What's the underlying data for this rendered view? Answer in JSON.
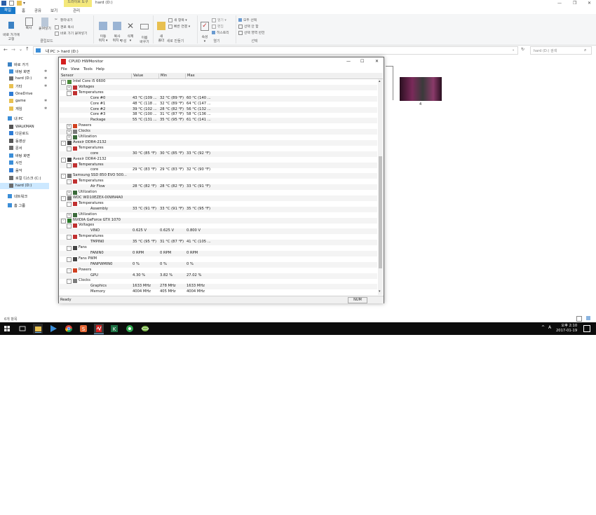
{
  "explorer": {
    "title": "hard (D:)",
    "context_tab": "드라이브 도구",
    "tabs": {
      "file": "파일",
      "home": "홈",
      "share": "공유",
      "view": "보기",
      "manage": "관리"
    },
    "ribbon": {
      "pin_label": "바로 가기에\n고정",
      "copy_label": "복사",
      "paste_label": "붙여넣기",
      "cut_label": "잘라내기",
      "copy_path_label": "경로 복사",
      "paste_shortcut_label": "바로 가기 붙여넣기",
      "clipboard_group": "클립보드",
      "move_to_label": "이동\n위치 ▾",
      "copy_to_label": "복사\n위치 ▾",
      "delete_label": "삭제\n▾",
      "rename_label": "이름\n바꾸기",
      "organize_group": "구성",
      "new_folder_label": "새\n폴더",
      "new_item_label": "새 항목 ▾",
      "easy_access_label": "빠른 연결 ▾",
      "new_group": "새로 만들기",
      "properties_label": "속성\n▾",
      "open_label": "열기 ▾",
      "edit_label": "편집",
      "history_label": "히스토리",
      "open_group": "열기",
      "select_all_label": "모두 선택",
      "select_none_label": "선택 안 함",
      "invert_label": "선택 영역 반전",
      "select_group": "선택"
    },
    "address": {
      "path": "내 PC  >  hard (D:)",
      "search_placeholder": "hard (D:) 검색"
    },
    "nav_items": [
      {
        "label": "바로 가기",
        "icon": "star-icon",
        "color": "#3b82c4"
      },
      {
        "label": "바탕 화면",
        "icon": "desktop-icon",
        "color": "#3b8ed8"
      },
      {
        "label": "hard (D:)",
        "icon": "drive-icon",
        "color": "#6b6b6b"
      },
      {
        "label": "기타",
        "icon": "folder-icon",
        "color": "#e8c050"
      },
      {
        "label": "OneDrive",
        "icon": "cloud-icon",
        "color": "#2f7bd4"
      },
      {
        "label": "game",
        "icon": "folder-icon",
        "color": "#e8c050"
      },
      {
        "label": "게임",
        "icon": "folder-icon",
        "color": "#e8c050"
      },
      {
        "label": "내 PC",
        "icon": "pc-icon",
        "color": "#3b8ed8"
      },
      {
        "label": "WALKMAN",
        "icon": "device-icon",
        "color": "#555555"
      },
      {
        "label": "다운로드",
        "icon": "download-icon",
        "color": "#2f7bd4"
      },
      {
        "label": "동영상",
        "icon": "video-icon",
        "color": "#555555"
      },
      {
        "label": "문서",
        "icon": "document-icon",
        "color": "#6b6b6b"
      },
      {
        "label": "바탕 화면",
        "icon": "desktop-icon",
        "color": "#3b8ed8"
      },
      {
        "label": "사진",
        "icon": "picture-icon",
        "color": "#3b8ed8"
      },
      {
        "label": "음악",
        "icon": "music-icon",
        "color": "#2f7bd4"
      },
      {
        "label": "로컬 디스크 (C:)",
        "icon": "drive-icon",
        "color": "#6b6b6b"
      },
      {
        "label": "hard (D:)",
        "icon": "drive-icon",
        "color": "#6b6b6b"
      },
      {
        "label": "네트워크",
        "icon": "network-icon",
        "color": "#3b8ed8"
      },
      {
        "label": "홈 그룹",
        "icon": "homegroup-icon",
        "color": "#3b8ed8"
      }
    ],
    "thumb_label": "4",
    "status": "6개 항목"
  },
  "hwmonitor": {
    "title": "CPUID HWMonitor",
    "menu": [
      "File",
      "View",
      "Tools",
      "Help"
    ],
    "columns": [
      "Sensor",
      "Value",
      "Min",
      "Max"
    ],
    "rows": [
      {
        "name": "Intel Core i5 6600",
        "level": 1,
        "expand": "-",
        "icon": "cpu-icon"
      },
      {
        "name": "Voltages",
        "level": 2,
        "expand": "+",
        "icon": "voltage-icon"
      },
      {
        "name": "Temperatures",
        "level": 2,
        "expand": "-",
        "icon": "thermometer-icon"
      },
      {
        "name": "Core #0",
        "level": 3,
        "value": "43 °C  (109 ...",
        "min": "32 °C  (89 °F)",
        "max": "60 °C  (140 ..."
      },
      {
        "name": "Core #1",
        "level": 3,
        "value": "48 °C  (118 ...",
        "min": "32 °C  (89 °F)",
        "max": "64 °C  (147 ..."
      },
      {
        "name": "Core #2",
        "level": 3,
        "value": "39 °C  (102 ...",
        "min": "28 °C  (82 °F)",
        "max": "56 °C  (132 ..."
      },
      {
        "name": "Core #3",
        "level": 3,
        "value": "38 °C  (100 ...",
        "min": "31 °C  (87 °F)",
        "max": "58 °C  (136 ..."
      },
      {
        "name": "Package",
        "level": 3,
        "value": "55 °C  (131 ...",
        "min": "35 °C  (95 °F)",
        "max": "61 °C  (141 ..."
      },
      {
        "name": "Powers",
        "level": 2,
        "expand": "+",
        "icon": "power-icon"
      },
      {
        "name": "Clocks",
        "level": 2,
        "expand": "+",
        "icon": "clock-icon"
      },
      {
        "name": "Utilization",
        "level": 2,
        "expand": "+",
        "icon": "utilization-icon"
      },
      {
        "name": "Avexir DDR4-2132",
        "level": 1,
        "expand": "-",
        "icon": "memory-icon"
      },
      {
        "name": "Temperatures",
        "level": 2,
        "expand": "-",
        "icon": "thermometer-icon"
      },
      {
        "name": "core",
        "level": 3,
        "value": "30 °C  (85 °F)",
        "min": "30 °C  (85 °F)",
        "max": "33 °C  (92 °F)"
      },
      {
        "name": "Avexir DDR4-2132",
        "level": 1,
        "expand": "-",
        "icon": "memory-icon"
      },
      {
        "name": "Temperatures",
        "level": 2,
        "expand": "-",
        "icon": "thermometer-icon"
      },
      {
        "name": "core",
        "level": 3,
        "value": "29 °C  (83 °F)",
        "min": "29 °C  (83 °F)",
        "max": "32 °C  (90 °F)"
      },
      {
        "name": "Samsung SSD 850 EVO 500...",
        "level": 1,
        "expand": "-",
        "icon": "disk-icon"
      },
      {
        "name": "Temperatures",
        "level": 2,
        "expand": "-",
        "icon": "thermometer-icon"
      },
      {
        "name": "Air Flow",
        "level": 3,
        "value": "28 °C  (82 °F)",
        "min": "28 °C  (82 °F)",
        "max": "33 °C  (91 °F)"
      },
      {
        "name": "Utilization",
        "level": 2,
        "expand": "+",
        "icon": "utilization-icon"
      },
      {
        "name": "WDC WD10EZEX-00WN4A0",
        "level": 1,
        "expand": "-",
        "icon": "disk-icon"
      },
      {
        "name": "Temperatures",
        "level": 2,
        "expand": "-",
        "icon": "thermometer-icon"
      },
      {
        "name": "Assembly",
        "level": 3,
        "value": "33 °C  (91 °F)",
        "min": "33 °C  (91 °F)",
        "max": "35 °C  (95 °F)"
      },
      {
        "name": "Utilization",
        "level": 2,
        "expand": "+",
        "icon": "utilization-icon"
      },
      {
        "name": "NVIDIA GeForce GTX 1070",
        "level": 1,
        "expand": "-",
        "icon": "gpu-icon"
      },
      {
        "name": "Voltages",
        "level": 2,
        "expand": "-",
        "icon": "voltage-icon"
      },
      {
        "name": "VINO",
        "level": 3,
        "value": "0.625 V",
        "min": "0.625 V",
        "max": "0.800 V"
      },
      {
        "name": "Temperatures",
        "level": 2,
        "expand": "-",
        "icon": "thermometer-icon"
      },
      {
        "name": "TMPIN0",
        "level": 3,
        "value": "35 °C  (95 °F)",
        "min": "31 °C  (87 °F)",
        "max": "41 °C  (105 ..."
      },
      {
        "name": "Fans",
        "level": 2,
        "expand": "-",
        "icon": "fan-icon"
      },
      {
        "name": "FANIN0",
        "level": 3,
        "value": "0 RPM",
        "min": "0 RPM",
        "max": "0 RPM"
      },
      {
        "name": "Fans PWM",
        "level": 2,
        "expand": "-",
        "icon": "fan-icon"
      },
      {
        "name": "FANPWMIN0",
        "level": 3,
        "value": "0 %",
        "min": "0 %",
        "max": "0 %"
      },
      {
        "name": "Powers",
        "level": 2,
        "expand": "-",
        "icon": "power-icon"
      },
      {
        "name": "GPU",
        "level": 3,
        "value": "4.30 %",
        "min": "3.82 %",
        "max": "27.02 %"
      },
      {
        "name": "Clocks",
        "level": 2,
        "expand": "-",
        "icon": "clock-icon"
      },
      {
        "name": "Graphics",
        "level": 3,
        "value": "1633 MHz",
        "min": "278 MHz",
        "max": "1633 MHz"
      },
      {
        "name": "Memory",
        "level": 3,
        "value": "4004 MHz",
        "min": "405 MHz",
        "max": "4004 MHz"
      }
    ],
    "status": "Ready",
    "num_indicator": "NUM"
  },
  "taskbar": {
    "apps": [
      "windows-start-icon",
      "task-view-icon",
      "file-explorer-icon",
      "chrome-icon",
      "media-player-icon",
      "sticky-app-icon",
      "hwmonitor-icon",
      "excel-like-icon",
      "green-app-icon",
      "network-tool-icon"
    ],
    "ime": "A",
    "time": "오후 2:10",
    "date": "2017-01-19"
  }
}
